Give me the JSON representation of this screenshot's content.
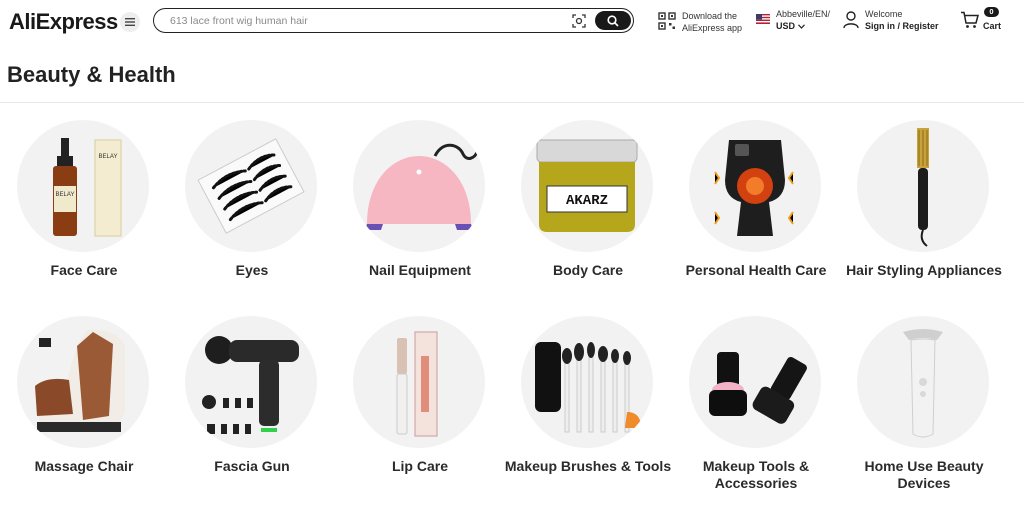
{
  "header": {
    "logo": "AliExpress",
    "search_placeholder": "613 lace front wig human hair",
    "app_download": {
      "line1": "Download the",
      "line2": "AliExpress app"
    },
    "locale": {
      "line1": "Abbeville/EN/",
      "line2": "USD"
    },
    "account": {
      "line1": "Welcome",
      "line2": "Sign in / Register"
    },
    "cart": {
      "count": "0",
      "label": "Cart"
    }
  },
  "page_title": "Beauty & Health",
  "categories": [
    {
      "label": "Face Care",
      "icon": "serum-bottle-image"
    },
    {
      "label": "Eyes",
      "icon": "false-lashes-image"
    },
    {
      "label": "Nail Equipment",
      "icon": "nail-lamp-image"
    },
    {
      "label": "Body Care",
      "icon": "body-butter-jar-image"
    },
    {
      "label": "Personal Health Care",
      "icon": "knee-massager-image"
    },
    {
      "label": "Hair Styling Appliances",
      "icon": "hot-comb-image"
    },
    {
      "label": "Massage Chair",
      "icon": "massage-chair-image"
    },
    {
      "label": "Fascia Gun",
      "icon": "massage-gun-image"
    },
    {
      "label": "Lip Care",
      "icon": "lip-gloss-image"
    },
    {
      "label": "Makeup Brushes & Tools",
      "icon": "brush-set-image"
    },
    {
      "label": "Makeup Tools & Accessories",
      "icon": "powder-puffs-image"
    },
    {
      "label": "Home Use Beauty Devices",
      "icon": "beauty-device-image"
    }
  ],
  "product_text": {
    "belay": "BELAY",
    "akarz": "AKARZ"
  },
  "colors": {
    "text": "#222222",
    "circle_bg": "#f2f2f2",
    "button": "#191919"
  }
}
